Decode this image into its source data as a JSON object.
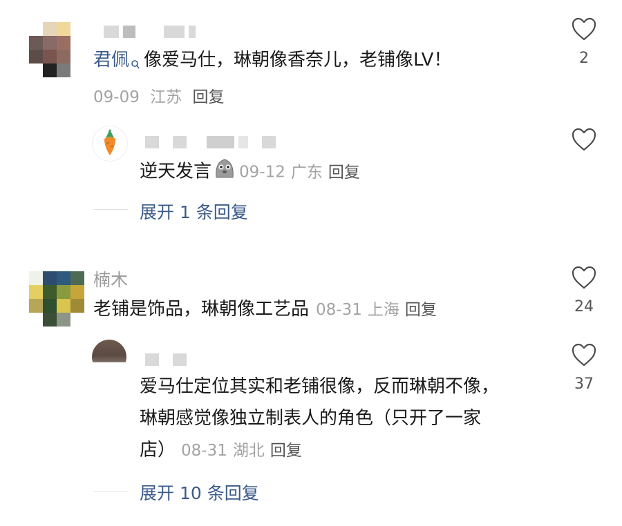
{
  "comments": [
    {
      "author": "君佩",
      "author_badge_icon": "search-badge-icon",
      "text": "像爱马仕，琳朝像香奈儿，老铺像LV！",
      "date": "09-09",
      "location": "江苏",
      "reply_label": "回复",
      "likes": "2"
    },
    {
      "text": "逆天发言",
      "date": "09-12",
      "location": "广东",
      "reply_label": "回复",
      "likes": "",
      "avatar_icon": "carrot-icon",
      "emoji_icon": "ghost-emoji-icon"
    },
    {
      "author": "楠木",
      "text": "老铺是饰品，琳朝像工艺品",
      "date": "08-31",
      "location": "上海",
      "reply_label": "回复",
      "likes": "24"
    },
    {
      "text_line1": "爱马仕定位其实和老铺很像，反而琳朝不像，",
      "text_line2": "琳朝感觉像独立制表人的角色（只开了一家",
      "text_line3": "店）",
      "date": "08-31",
      "location": "湖北",
      "reply_label": "回复",
      "likes": "37"
    }
  ],
  "expand_1": "展开 1 条回复",
  "expand_2": "展开 10 条回复",
  "colors": {
    "link_blue": "#3b5a8a",
    "meta_gray": "#a3a3a3",
    "text": "#1a1a1a"
  }
}
